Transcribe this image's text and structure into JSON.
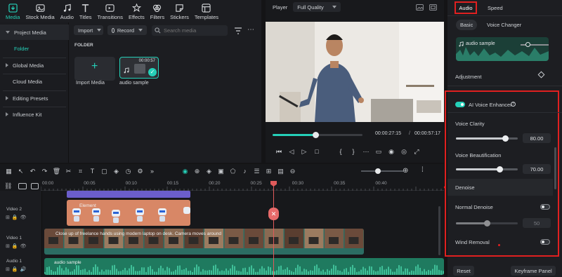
{
  "toolbar": {
    "items": [
      {
        "label": "Media",
        "icon": "media-import-icon",
        "active": true
      },
      {
        "label": "Stock Media",
        "icon": "stock-media-icon"
      },
      {
        "label": "Audio",
        "icon": "music-note-icon"
      },
      {
        "label": "Titles",
        "icon": "title-t-icon"
      },
      {
        "label": "Transitions",
        "icon": "transitions-icon"
      },
      {
        "label": "Effects",
        "icon": "effects-icon"
      },
      {
        "label": "Filters",
        "icon": "filters-icon"
      },
      {
        "label": "Stickers",
        "icon": "stickers-icon"
      },
      {
        "label": "Templates",
        "icon": "templates-icon"
      }
    ]
  },
  "sidebar": {
    "items": [
      {
        "label": "Project Media",
        "expanded": true
      },
      {
        "label": "Folder"
      },
      {
        "label": "Global Media"
      },
      {
        "label": "Cloud Media"
      },
      {
        "label": "Editing Presets"
      },
      {
        "label": "Influence Kit"
      }
    ]
  },
  "media": {
    "import_label": "Import",
    "record_label": "Record",
    "search_placeholder": "Search media",
    "folder_heading": "FOLDER",
    "tiles": [
      {
        "label": "Import Media"
      },
      {
        "label": "audio sample",
        "duration": "00:00:57"
      }
    ]
  },
  "player": {
    "label": "Player",
    "quality": "Full Quality",
    "current_time": "00:00:27:15",
    "total_time": "00:00:57:17",
    "progress": 0.48
  },
  "right_panel": {
    "tabs": [
      {
        "label": "Audio",
        "active": true
      },
      {
        "label": "Speed"
      }
    ],
    "subtabs": [
      {
        "label": "Basic",
        "active": true
      },
      {
        "label": "Voice Changer"
      }
    ],
    "audio_clip_label": "audio sample",
    "adjustment_label": "Adjustment",
    "ai_voice_enhancer": {
      "label": "AI Voice Enhancer",
      "enabled": true
    },
    "voice_clarity": {
      "label": "Voice Clarity",
      "value": "80.00",
      "level": 0.8
    },
    "voice_beautification": {
      "label": "Voice Beautification",
      "value": "70.00",
      "level": 0.7
    },
    "denoise_heading": "Denoise",
    "normal_denoise": {
      "label": "Normal Denoise",
      "value": "50",
      "enabled": false,
      "level": 0.5
    },
    "wind_removal": {
      "label": "Wind Removal",
      "enabled": false
    },
    "reset_label": "Reset",
    "keyframe_label": "Keyframe Panel",
    "highlight_color": "#e02020"
  },
  "timeline": {
    "ruler_ticks": [
      "00:00",
      "00:05",
      "00:10",
      "00:15",
      "00:20",
      "00:25",
      "00:30",
      "00:35",
      "00:40"
    ],
    "tracks": [
      {
        "name": "Video 2"
      },
      {
        "name": "Video 1"
      },
      {
        "name": "Audio 1"
      }
    ],
    "video1_clip_text": "Close up of freelance hands using modern laptop on desk. Camera moves around",
    "audio_clip_text": "audio sample",
    "overlay_clip_text": "Element"
  },
  "colors": {
    "accent": "#25d0b8",
    "orange_clip": "#d88766",
    "purple_clip": "#6b5ecb",
    "audio_clip": "#1f7a5f",
    "playhead": "#e05a5a"
  }
}
